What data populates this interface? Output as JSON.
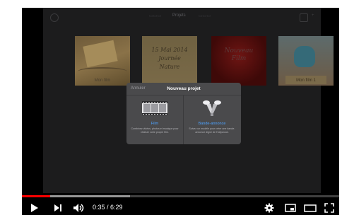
{
  "player": {
    "time_current": "0:35",
    "time_separator": " / ",
    "time_total": "6:29",
    "progress_played": 0.0899,
    "progress_buffered": 0.34,
    "accent_color": "#ff0000"
  },
  "ipad": {
    "topbar": {
      "tab_projects": "Projets"
    },
    "thumbnails": [
      {
        "label": "Mon film"
      },
      {
        "line1": "15 Mai 2014",
        "line2": "Journée",
        "line3": "Nature"
      },
      {
        "line1": "Nouveau",
        "line2": "Film"
      },
      {
        "label": "Mon film 1"
      }
    ],
    "dialog": {
      "cancel": "Annuler",
      "title": "Nouveau projet",
      "film_label": "Film",
      "film_desc": "Combinez vidéos, photos et musique pour réaliser votre propre film.",
      "trailer_label": "Bande-annonce",
      "trailer_desc": "Suivez un modèle pour créer une bande-annonce digne de Hollywood."
    }
  },
  "icons": {
    "play": "play-icon",
    "next": "next-icon",
    "volume": "volume-icon",
    "settings": "gear-icon",
    "miniplayer": "miniplayer-icon",
    "theater": "theater-icon",
    "fullscreen": "fullscreen-icon"
  }
}
